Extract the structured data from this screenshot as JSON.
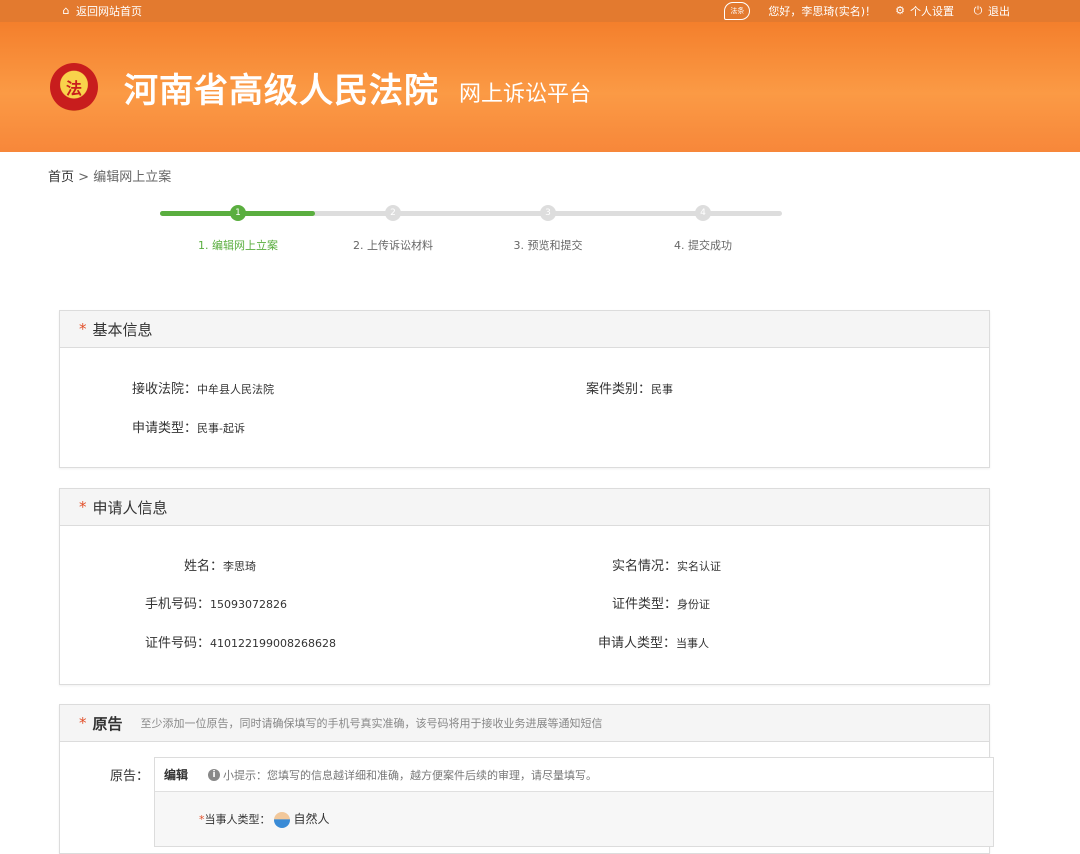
{
  "topbar": {
    "back_link": "返回网站首页",
    "faq_icon_text": "法条",
    "greeting": "您好，李思琦(实名)！",
    "settings": "个人设置",
    "logout": "退出"
  },
  "header": {
    "court_name": "河南省高级人民法院",
    "platform_name": "网上诉讼平台",
    "emblem_text": "法"
  },
  "breadcrumb": {
    "home": "首页",
    "separator": " > ",
    "current": "编辑网上立案"
  },
  "steps": [
    {
      "num": "1",
      "label": "1. 编辑网上立案",
      "active": true
    },
    {
      "num": "2",
      "label": "2. 上传诉讼材料",
      "active": false
    },
    {
      "num": "3",
      "label": "3. 预览和提交",
      "active": false
    },
    {
      "num": "4",
      "label": "4. 提交成功",
      "active": false
    }
  ],
  "basic_info": {
    "title": "基本信息",
    "star": "*",
    "court_label": "接收法院：",
    "court_value": "中牟县人民法院",
    "case_type_label": "案件类别：",
    "case_type_value": "民事",
    "apply_type_label": "申请类型：",
    "apply_type_value": "民事-起诉"
  },
  "applicant_info": {
    "title": "申请人信息",
    "star": "*",
    "name_label": "姓名：",
    "name_value": "李思琦",
    "realname_label": "实名情况：",
    "realname_value": "实名认证",
    "phone_label": "手机号码：",
    "phone_value": "15093072826",
    "id_type_label": "证件类型：",
    "id_type_value": "身份证",
    "id_no_label": "证件号码：",
    "id_no_value": "410122199008268628",
    "applicant_type_label": "申请人类型：",
    "applicant_type_value": "当事人"
  },
  "plaintiff": {
    "title": "原告",
    "star": "*",
    "tip": "至少添加一位原告，同时请确保填写的手机号真实准确，该号码将用于接收业务进展等通知短信",
    "row_label": "原告：",
    "edit": "编辑",
    "hint": "小提示：您填写的信息越详细和准确，越方便案件后续的审理，请尽量填写。",
    "party_type_label": "当事人类型：",
    "party_type_star": "*",
    "party_type_value": "自然人"
  },
  "colors": {
    "brand_orange": "#f47f2c",
    "step_green": "#5aae3f",
    "required_red": "#e2502a"
  }
}
